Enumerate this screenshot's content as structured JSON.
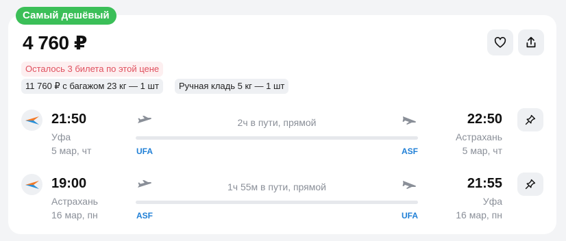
{
  "badge": "Самый дешёвый",
  "price": "4 760 ₽",
  "actions": {
    "favorite_icon": "heart-icon",
    "share_icon": "share-icon"
  },
  "warning": "Осталось 3 билета по этой цене",
  "options": [
    "11 760 ₽ с багажом 23 кг — 1 шт",
    "Ручная кладь 5 кг — 1 шт"
  ],
  "segments": [
    {
      "dep_time": "21:50",
      "dep_city": "Уфа",
      "dep_date": "5 мар, чт",
      "dep_code": "UFA",
      "duration": "2ч в пути, прямой",
      "arr_time": "22:50",
      "arr_city": "Астрахань",
      "arr_date": "5 мар, чт",
      "arr_code": "ASF"
    },
    {
      "dep_time": "19:00",
      "dep_city": "Астрахань",
      "dep_date": "16 мар, пн",
      "dep_code": "ASF",
      "duration": "1ч 55м в пути, прямой",
      "arr_time": "21:55",
      "arr_city": "Уфа",
      "arr_date": "16 мар, пн",
      "arr_code": "UFA"
    }
  ],
  "colors": {
    "badge": "#3bbf58",
    "warning_text": "#e0505e",
    "warning_bg": "#fdeff0",
    "airport_code": "#1f7fd6"
  }
}
